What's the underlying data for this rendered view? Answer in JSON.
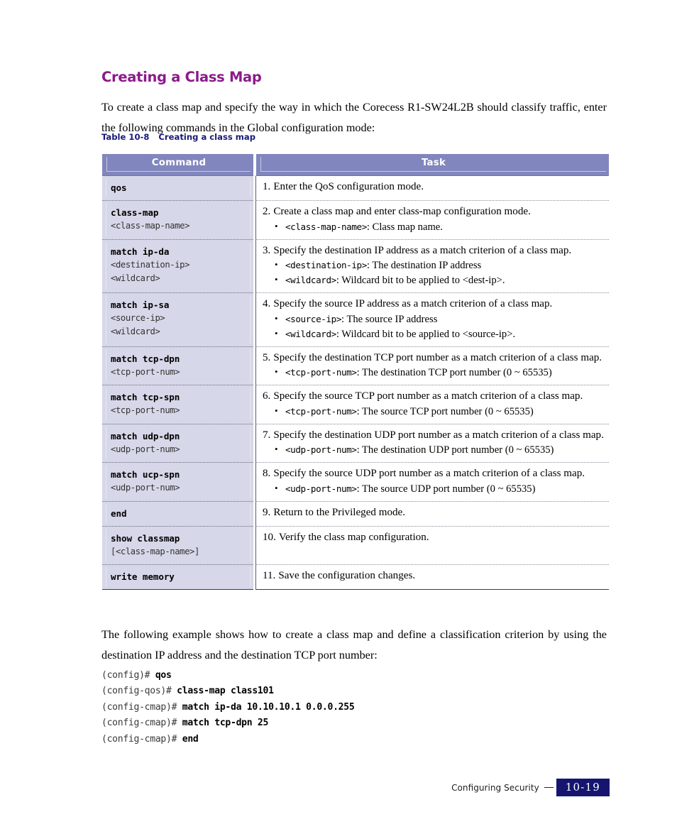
{
  "heading": "Creating a Class Map",
  "intro_paragraph": "To create a class map and specify the way in which the Corecess R1-SW24L2B should classify traffic, enter the following commands in the Global configuration mode:",
  "table_caption": {
    "number": "Table 10-8",
    "title": "Creating a class map"
  },
  "table": {
    "headers": {
      "command": "Command",
      "task": "Task"
    },
    "rows": [
      {
        "command": "qos",
        "args": [],
        "step_num": "1.",
        "step_text": "Enter the QoS configuration mode.",
        "bullets": []
      },
      {
        "command": "class-map",
        "args": [
          "<class-map-name>"
        ],
        "step_num": "2.",
        "step_text": "Create a class map and enter class-map configuration mode.",
        "bullets": [
          {
            "code": "<class-map-name>",
            "text": ": Class map name."
          }
        ]
      },
      {
        "command": "match ip-da",
        "args": [
          "<destination-ip>",
          "<wildcard>"
        ],
        "step_num": "3.",
        "step_text": "Specify the destination IP address as a match criterion of a class map.",
        "bullets": [
          {
            "code": "<destination-ip>",
            "text": ": The destination IP address"
          },
          {
            "code": "<wildcard>",
            "text": ": Wildcard bit to be applied to <dest-ip>."
          }
        ]
      },
      {
        "command": "match ip-sa",
        "args": [
          "<source-ip>",
          "<wildcard>"
        ],
        "step_num": "4.",
        "step_text": "Specify the source IP address as a match criterion of a class map.",
        "bullets": [
          {
            "code": "<source-ip>",
            "text": ": The source IP address"
          },
          {
            "code": "<wildcard>",
            "text": ": Wildcard bit to be applied to <source-ip>."
          }
        ]
      },
      {
        "command": "match tcp-dpn",
        "args": [
          "<tcp-port-num>"
        ],
        "step_num": "5.",
        "step_text": "Specify the destination TCP port number as a match criterion of a class map.",
        "bullets": [
          {
            "code": "<tcp-port-num>",
            "text": ": The destination TCP port number    (0 ~ 65535)"
          }
        ]
      },
      {
        "command": "match tcp-spn",
        "args": [
          "<tcp-port-num>"
        ],
        "step_num": "6.",
        "step_text": "Specify the source TCP port number as a match criterion of a class map.",
        "bullets": [
          {
            "code": "<tcp-port-num>",
            "text": ": The source TCP port number (0 ~ 65535)"
          }
        ]
      },
      {
        "command": "match udp-dpn",
        "args": [
          "<udp-port-num>"
        ],
        "step_num": "7.",
        "step_text": "Specify the destination UDP port number as a match criterion of a class map.",
        "bullets": [
          {
            "code": "<udp-port-num>",
            "text": ": The destination UDP port number (0 ~ 65535)"
          }
        ]
      },
      {
        "command": "match ucp-spn",
        "args": [
          "<udp-port-num>"
        ],
        "step_num": "8.",
        "step_text": "Specify the source UDP port number as a match criterion of a class map.",
        "bullets": [
          {
            "code": "<udp-port-num>",
            "text": ": The source UDP port number (0 ~ 65535)"
          }
        ]
      },
      {
        "command": "end",
        "args": [],
        "step_num": "9.",
        "step_text": "Return to the Privileged mode.",
        "bullets": []
      },
      {
        "command": "show classmap",
        "args": [
          "[<class-map-name>]"
        ],
        "step_num": "10.",
        "step_text": "Verify the class map configuration.",
        "bullets": []
      },
      {
        "command": "write memory",
        "args": [],
        "step_num": "11.",
        "step_text": "Save the configuration changes.",
        "bullets": []
      }
    ]
  },
  "follow_paragraph": "The following example shows how to create a class map and define a classification criterion by using the destination IP address and the destination TCP port number:",
  "cli_example": [
    {
      "prompt": "(config)# ",
      "entered": "qos"
    },
    {
      "prompt": "(config-qos)# ",
      "entered": "class-map class101"
    },
    {
      "prompt": "(config-cmap)# ",
      "entered": "match ip-da 10.10.10.1 0.0.0.255"
    },
    {
      "prompt": "(config-cmap)# ",
      "entered": "match tcp-dpn 25"
    },
    {
      "prompt": "(config-cmap)# ",
      "entered": "end"
    }
  ],
  "footer": {
    "label": "Configuring Security",
    "page_number": "10-19"
  },
  "colors": {
    "heading": "#8C1A8C",
    "caption": "#181878",
    "table_header_bg": "#8286BE",
    "command_cell_bg": "#D6D7E8",
    "page_badge_bg": "#151570"
  }
}
